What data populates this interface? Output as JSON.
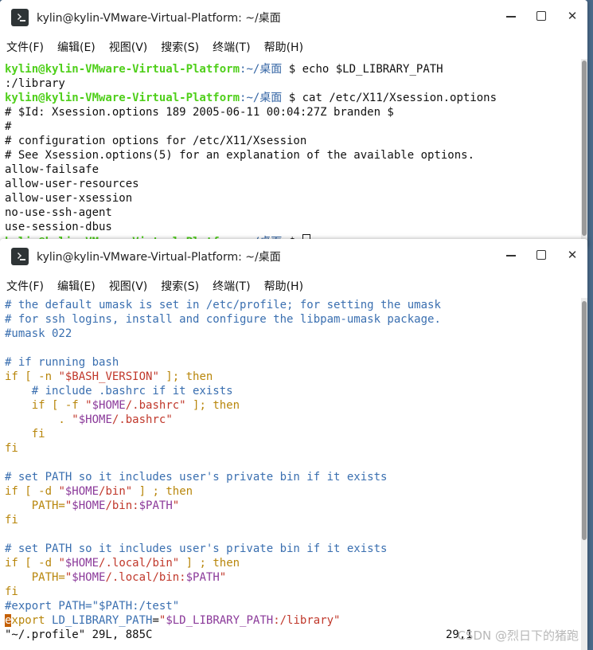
{
  "window1": {
    "title": "kylin@kylin-VMware-Virtual-Platform: ~/桌面",
    "menu": [
      "文件(F)",
      "编辑(E)",
      "视图(V)",
      "搜索(S)",
      "终端(T)",
      "帮助(H)"
    ],
    "prompt_user": "kylin@kylin-VMware-Virtual-Platform",
    "prompt_path": ":~/桌面",
    "cmd1": "$ echo $LD_LIBRARY_PATH",
    "out1": ":/library",
    "cmd2": "$ cat /etc/X11/Xsession.options",
    "lines": [
      "# $Id: Xsession.options 189 2005-06-11 00:04:27Z branden $",
      "#",
      "# configuration options for /etc/X11/Xsession",
      "# See Xsession.options(5) for an explanation of the available options.",
      "allow-failsafe",
      "allow-user-resources",
      "allow-user-xsession",
      "no-use-ssh-agent",
      "use-session-dbus"
    ],
    "last_prompt_tail": "$"
  },
  "window2": {
    "title": "kylin@kylin-VMware-Virtual-Platform: ~/桌面",
    "menu": [
      "文件(F)",
      "编辑(E)",
      "视图(V)",
      "搜索(S)",
      "终端(T)",
      "帮助(H)"
    ],
    "editor": {
      "c1": "# the default umask is set in /etc/profile; for setting the umask",
      "c2": "# for ssh logins, install and configure the libpam-umask package.",
      "c3": "#umask 022",
      "c4": "# if running bash",
      "if1_a": "if [ -n ",
      "if1_str": "\"$BASH_VERSION\"",
      "if1_b": " ]; then",
      "c5": "    # include .bashrc if it exists",
      "if2_a": "    if [ -f ",
      "if2_q1": "\"",
      "if2_var": "$HOME",
      "if2_rest": "/.bashrc\"",
      "if2_b": " ]; then",
      "dot_a": "        . ",
      "dot_q1": "\"",
      "dot_var": "$HOME",
      "dot_rest": "/.bashrc\"",
      "fi_in": "    fi",
      "fi": "fi",
      "c6": "# set PATH so it includes user's private bin if it exists",
      "if3_a": "if [ -d ",
      "if3_q1": "\"",
      "if3_var": "$HOME",
      "if3_rest": "/bin\"",
      "if3_b": " ] ; then",
      "p1_a": "    PATH=",
      "p1_q1": "\"",
      "p1_var": "$HOME",
      "p1_mid": "/bin:",
      "p1_var2": "$PATH",
      "p1_q2": "\"",
      "fi2": "fi",
      "c7": "# set PATH so it includes user's private bin if it exists",
      "if4_a": "if [ -d ",
      "if4_q1": "\"",
      "if4_var": "$HOME",
      "if4_rest": "/.local/bin\"",
      "if4_b": " ] ; then",
      "p2_a": "    PATH=",
      "p2_q1": "\"",
      "p2_var": "$HOME",
      "p2_mid": "/.local/bin:",
      "p2_var2": "$PATH",
      "p2_q2": "\"",
      "fi3": "fi",
      "c8": "#export PATH=\"$PATH:/test\"",
      "exp_cursor": "e",
      "exp_a": "xport ",
      "exp_name": "LD_LIBRARY_PATH",
      "exp_eq": "=",
      "exp_q1": "\"",
      "exp_var": "$LD_LIBRARY_PATH",
      "exp_rest": ":/library\"",
      "status_file": "\"~/.profile\" 29L, 885C",
      "status_pos": "29,1"
    }
  },
  "watermark": "CSDN @烈日下的猪跑"
}
